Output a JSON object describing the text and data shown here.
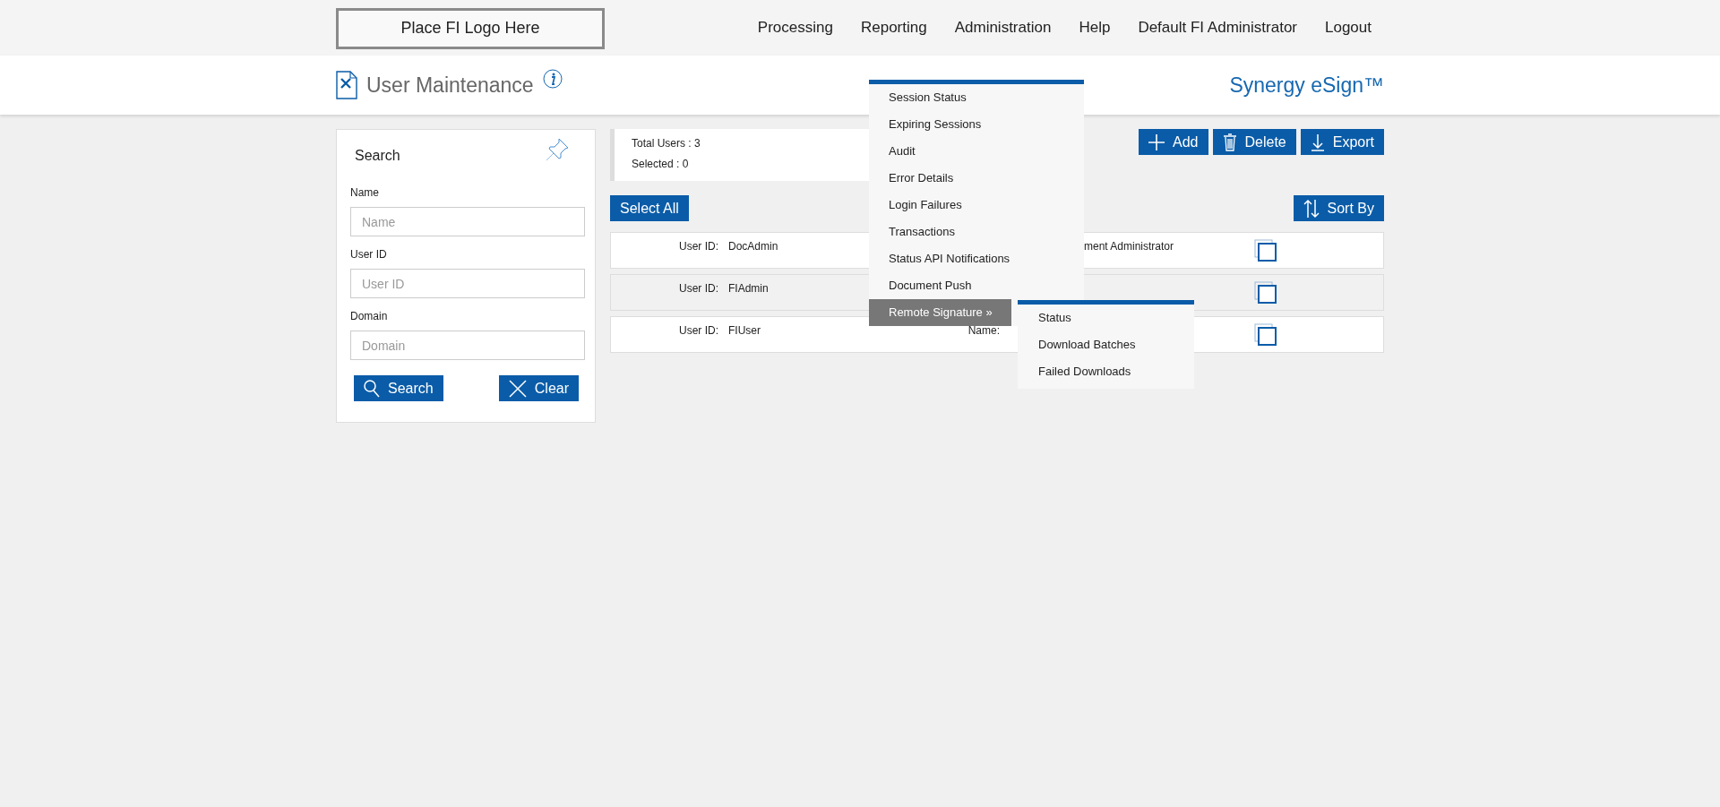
{
  "header": {
    "logo": "Place FI Logo Here",
    "nav": [
      "Processing",
      "Reporting",
      "Administration",
      "Help",
      "Default FI Administrator",
      "Logout"
    ]
  },
  "title_bar": {
    "title": "User Maintenance",
    "brand": "Synergy eSign™"
  },
  "dropdown": {
    "items": [
      {
        "label": "Session Status",
        "selected": false
      },
      {
        "label": "Expiring Sessions",
        "selected": false
      },
      {
        "label": "Audit",
        "selected": false
      },
      {
        "label": "Error Details",
        "selected": false
      },
      {
        "label": "Login Failures",
        "selected": false
      },
      {
        "label": "Transactions",
        "selected": false
      },
      {
        "label": "Status API Notifications",
        "selected": false
      },
      {
        "label": "Document Push",
        "selected": false
      },
      {
        "label": "Remote Signature »",
        "selected": true,
        "children": [
          {
            "label": "Status"
          },
          {
            "label": "Download Batches"
          },
          {
            "label": "Failed Downloads"
          }
        ]
      }
    ]
  },
  "search_panel": {
    "title": "Search",
    "fields": [
      {
        "label": "Name",
        "placeholder": "Name"
      },
      {
        "label": "User ID",
        "placeholder": "User ID"
      },
      {
        "label": "Domain",
        "placeholder": "Domain"
      }
    ],
    "buttons": [
      {
        "kind": "search",
        "label": "Search"
      },
      {
        "kind": "clear",
        "label": "Clear"
      }
    ]
  },
  "summary": {
    "total": "Total Users : 3",
    "selected": "Selected : 0"
  },
  "toolbar": [
    {
      "kind": "add",
      "label": "Add"
    },
    {
      "kind": "delete",
      "label": "Delete"
    },
    {
      "kind": "export",
      "label": "Export"
    }
  ],
  "select_all": "Select All",
  "sort": "Sort By",
  "users": [
    {
      "id_label": "User ID:",
      "id": "DocAdmin",
      "name_value": "ment Administrator",
      "hovered": false,
      "checked": false
    },
    {
      "id_label": "User ID:",
      "id": "FIAdmin",
      "hovered": true,
      "checked": false
    },
    {
      "id_label": "User ID:",
      "id": "FIUser",
      "name_label": "Name:",
      "hovered": false,
      "checked": false
    }
  ]
}
